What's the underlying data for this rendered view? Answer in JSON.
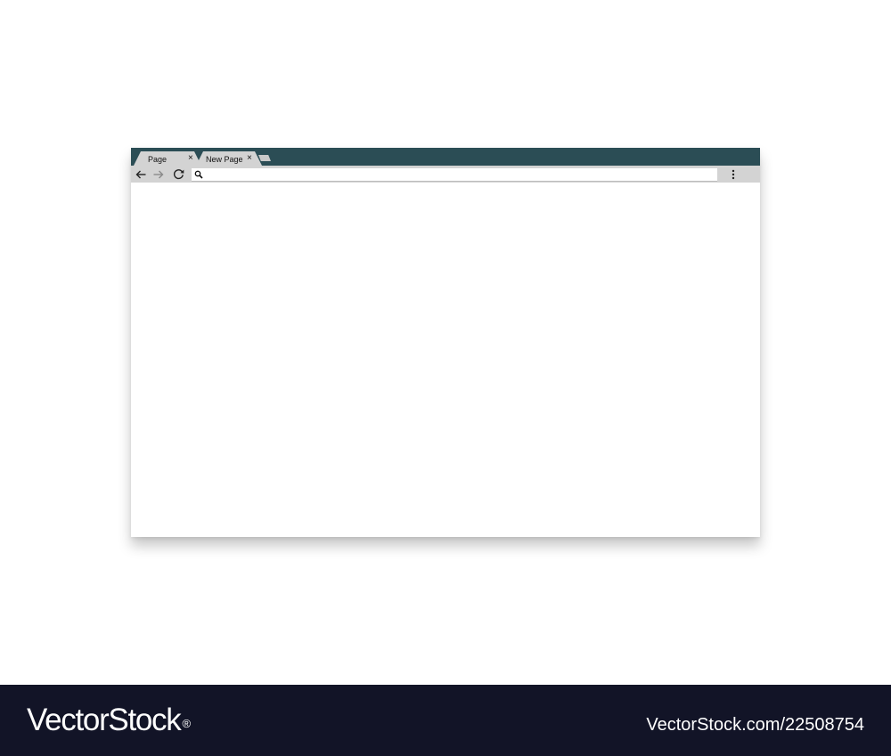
{
  "browser": {
    "tabs": [
      {
        "label": "Page",
        "close": "×"
      },
      {
        "label": "New Page",
        "close": "×"
      }
    ],
    "toolbar": {
      "back_icon": "arrow-left-icon",
      "forward_icon": "arrow-right-icon",
      "reload_icon": "reload-icon",
      "search_icon": "search-icon",
      "menu_icon": "kebab-menu-icon",
      "address_value": "",
      "address_placeholder": ""
    },
    "colors": {
      "titlebar": "#2b4d55",
      "tab": "#d3d3d3",
      "toolbar": "#d3d3d3",
      "footer": "#121427"
    }
  },
  "watermark": {
    "brand": "VectorStock",
    "registered": "®",
    "image_id": "VectorStock.com/22508754"
  }
}
